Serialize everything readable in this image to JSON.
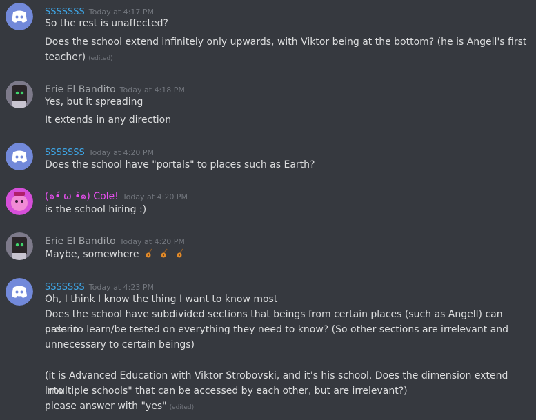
{
  "messages": [
    {
      "author": "SSSSSSS",
      "time": "Today at 4:17 PM",
      "lines": [
        "So the rest is unaffected?",
        "Does the school extend infinitely only upwards, with Viktor being at the bottom? (he is Angell's first",
        "teacher)"
      ],
      "edited": "(edited)"
    },
    {
      "author": "Erie El Bandito",
      "time": "Today at 4:18 PM",
      "lines": [
        "Yes, but it spreading",
        "It extends in any direction"
      ]
    },
    {
      "author": "SSSSSSS",
      "time": "Today at 4:20 PM",
      "lines": [
        "Does the school have \"portals\" to places such as Earth?"
      ]
    },
    {
      "author": "(๑•́ ω •̀๑) Cole!",
      "time": "Today at 4:20 PM",
      "lines": [
        "is the school hiring :)"
      ]
    },
    {
      "author": "Erie El Bandito",
      "time": "Today at 4:20 PM",
      "lines": [
        "Maybe, somewhere"
      ],
      "emojis": [
        "guitar-emoji",
        "guitar-emoji",
        "guitar-emoji"
      ]
    },
    {
      "author": "SSSSSSS",
      "time": "Today at 4:23 PM",
      "lines": [
        "Oh, I think I know the thing I want to know most",
        "Does the school have subdivided sections that beings from certain places (such as Angell) can pass in",
        "order to learn/be tested on everything they need to know? (So other sections are irrelevant and",
        "unnecessary to certain beings)",
        "",
        "(it is Advanced Education with Viktor Strobovski, and it's his school. Does the dimension extend into",
        "\"multiple schools\" that can be accessed by each other, but are irrelevant?)",
        "please answer with \"yes\""
      ],
      "edited": "(edited)"
    }
  ],
  "colors": {
    "background": "#36393f",
    "discord_blurple": "#7289da",
    "author_default": "#3ea6e6",
    "author_cole": "#e84ff0",
    "text": "#dcddde",
    "timestamp": "#72767d"
  }
}
